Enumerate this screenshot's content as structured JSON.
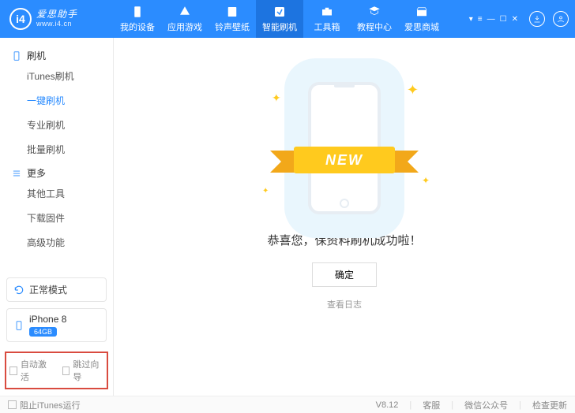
{
  "app": {
    "brand": "爱思助手",
    "site": "www.i4.cn",
    "logo_letters": "i4"
  },
  "nav": [
    {
      "id": "device",
      "label": "我的设备"
    },
    {
      "id": "apps",
      "label": "应用游戏"
    },
    {
      "id": "ring",
      "label": "铃声壁纸"
    },
    {
      "id": "flash",
      "label": "智能刷机",
      "active": true
    },
    {
      "id": "tools",
      "label": "工具箱"
    },
    {
      "id": "tutorial",
      "label": "教程中心"
    },
    {
      "id": "store",
      "label": "爱思商城"
    }
  ],
  "sidebar": {
    "group1": {
      "title": "刷机",
      "items": [
        {
          "id": "itunes",
          "label": "iTunes刷机"
        },
        {
          "id": "onekey",
          "label": "一键刷机",
          "active": true
        },
        {
          "id": "pro",
          "label": "专业刷机"
        },
        {
          "id": "batch",
          "label": "批量刷机"
        }
      ]
    },
    "group2": {
      "title": "更多",
      "items": [
        {
          "id": "other",
          "label": "其他工具"
        },
        {
          "id": "fw",
          "label": "下载固件"
        },
        {
          "id": "adv",
          "label": "高级功能"
        }
      ]
    },
    "mode": "正常模式",
    "device": {
      "name": "iPhone 8",
      "storage": "64GB"
    },
    "options": {
      "auto_activate": "自动激活",
      "skip_guide": "跳过向导"
    }
  },
  "main": {
    "ribbon": "NEW",
    "title": "恭喜您，保资料刷机成功啦！",
    "ok": "确定",
    "log": "查看日志"
  },
  "footer": {
    "block_itunes": "阻止iTunes运行",
    "version": "V8.12",
    "service": "客服",
    "wechat": "微信公众号",
    "update": "检查更新"
  }
}
